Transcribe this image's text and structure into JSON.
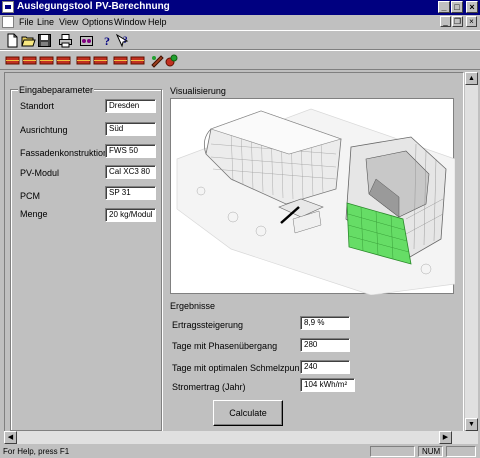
{
  "window": {
    "title": "Auslegungstool PV-Berechnung",
    "minimize_glyph": "_",
    "maximize_glyph": "□",
    "close_glyph": "×"
  },
  "menu": {
    "items": [
      "File",
      "Line",
      "View",
      "Options",
      "Window",
      "Help"
    ],
    "mdi_minimize": "_",
    "mdi_restore": "❐",
    "mdi_close": "×"
  },
  "toolbar1": {
    "icons": [
      "new-document-icon",
      "open-folder-icon",
      "save-disk-icon",
      "print-icon",
      "preview-icon",
      "help-icon",
      "context-help-icon"
    ]
  },
  "toolbar2": {
    "icons": [
      "module-1-icon",
      "module-2-icon",
      "module-3-icon",
      "module-4-icon",
      "module-5-icon",
      "module-6-icon",
      "module-7-icon",
      "module-8-icon",
      "module-9-icon"
    ]
  },
  "input_group": {
    "title": "Eingabeparameter",
    "params": [
      {
        "label": "Standort",
        "value": "Dresden"
      },
      {
        "label": "Ausrichtung",
        "value": "Süd"
      },
      {
        "label": "Fassadenkonstruktion",
        "value": "FWS 50"
      },
      {
        "label": "PV-Modul",
        "value": "Cal XC3 80"
      },
      {
        "label": "PCM",
        "value": "SP 31"
      },
      {
        "label": "Menge",
        "value": "20 kg/Modul"
      }
    ]
  },
  "visualization": {
    "title": "Visualisierung",
    "highlight_color": "#66dd66"
  },
  "results": {
    "title": "Ergebnisse",
    "items": [
      {
        "label": "Ertragssteigerung",
        "value": "8,9 %"
      },
      {
        "label": "Tage mit Phasenübergang",
        "value": "280"
      },
      {
        "label": "Tage mit optimalen Schmelzpunkt",
        "value": "240"
      },
      {
        "label": "Stromertrag (Jahr)",
        "value": "104 kWh/m²"
      }
    ]
  },
  "actions": {
    "calculate_label": "Calculate"
  },
  "scrollbars": {
    "up": "▲",
    "down": "▼",
    "left": "◀",
    "right": "▶"
  },
  "status": {
    "help_text": "For Help, press F1",
    "num_indicator": "NUM"
  }
}
